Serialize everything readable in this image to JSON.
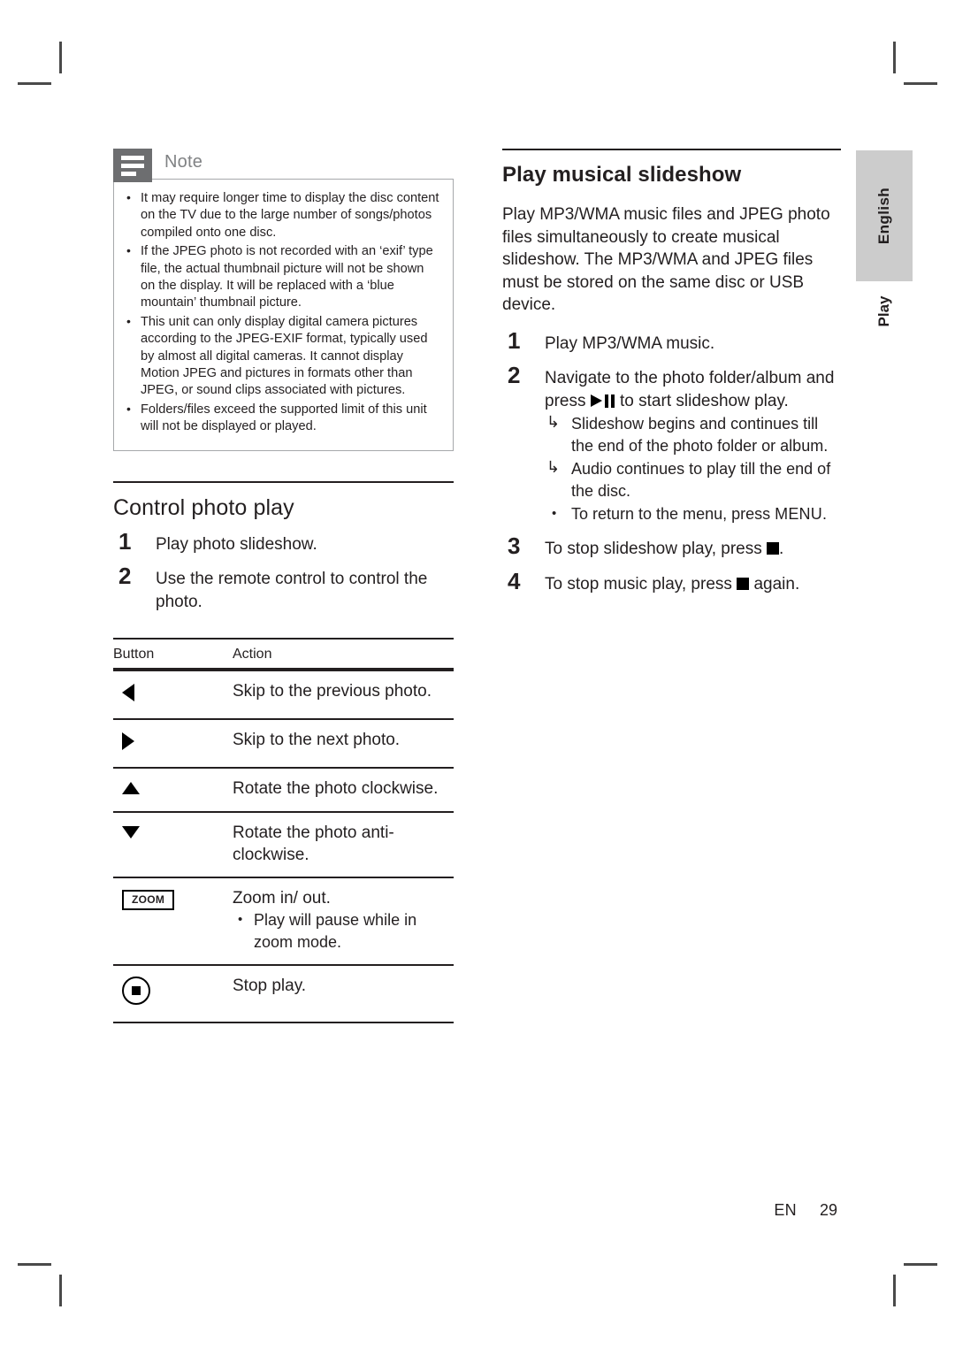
{
  "note": {
    "icon": "note-lines-icon",
    "title": "Note",
    "bullets": [
      "It may require longer time to display the disc content on the TV due to the large number of songs/photos compiled onto one disc.",
      "If the JPEG photo is not recorded with an ‘exif’ type file, the actual thumbnail picture will not be shown on the display.  It will be replaced with a ‘blue mountain’ thumbnail picture.",
      "This unit can only display digital camera pictures according to the JPEG-EXIF format, typically used by almost all digital cameras.  It cannot display Motion JPEG and pictures in formats other than JPEG, or sound clips associated with pictures.",
      "Folders/files exceed the supported limit of this unit will not be displayed or played."
    ]
  },
  "control_photo_play": {
    "heading": "Control photo play",
    "steps": [
      {
        "num": "1",
        "text": "Play photo slideshow."
      },
      {
        "num": "2",
        "text": "Use the remote control to control the photo."
      }
    ],
    "table": {
      "headers": [
        "Button",
        "Action"
      ],
      "rows": [
        {
          "button_icon": "arrow-left-icon",
          "action": "Skip to the previous photo."
        },
        {
          "button_icon": "arrow-right-icon",
          "action": "Skip to the next photo."
        },
        {
          "button_icon": "arrow-up-icon",
          "action": "Rotate the photo clockwise."
        },
        {
          "button_icon": "arrow-down-icon",
          "action": "Rotate the photo anti-clockwise."
        },
        {
          "button_icon": "zoom-key-icon",
          "button_label": "ZOOM",
          "action": "Zoom in/ out.",
          "sub": [
            "Play will pause while in zoom mode."
          ]
        },
        {
          "button_icon": "stop-key-icon",
          "action": "Stop play."
        }
      ]
    }
  },
  "play_musical_slideshow": {
    "heading": "Play musical slideshow",
    "intro": "Play MP3/WMA music files and JPEG photo files simultaneously to create musical slideshow. The MP3/WMA and JPEG files must be stored on the same disc or USB device.",
    "steps": [
      {
        "num": "1",
        "text": "Play MP3/WMA music."
      },
      {
        "num": "2",
        "text_before": "Navigate to the photo folder/album and press ",
        "glyph": "play-pause-icon",
        "text_after": " to start slideshow play.",
        "sub_arrows": [
          "Slideshow begins and continues till the end of the photo folder or album.",
          "Audio continues to play till the end of the disc."
        ],
        "sub_bullets": [
          {
            "text_before": "To return to the menu, press ",
            "keyword": "MENU",
            "text_after": "."
          }
        ]
      },
      {
        "num": "3",
        "text_before": "To stop slideshow play, press ",
        "glyph": "stop-square-icon",
        "text_after": "."
      },
      {
        "num": "4",
        "text_before": "To stop music play, press ",
        "glyph": "stop-square-icon",
        "text_after": " again."
      }
    ]
  },
  "side_tab": {
    "language": "English",
    "section": "Play"
  },
  "footer": {
    "language_code": "EN",
    "page_number": "29"
  }
}
